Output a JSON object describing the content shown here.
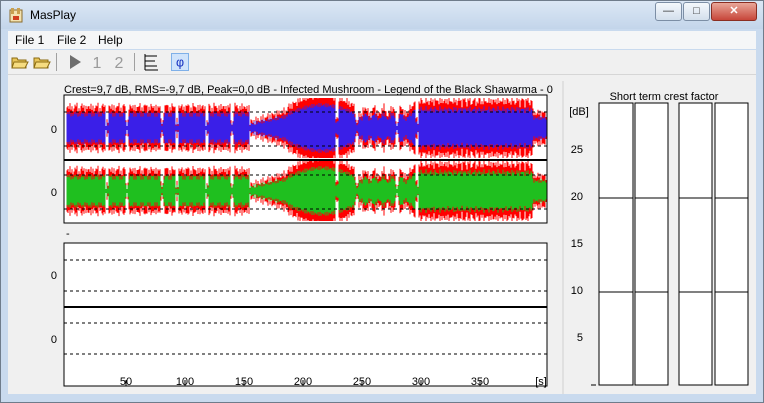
{
  "window": {
    "title": "MasPlay",
    "controls": {
      "minimize": "—",
      "maximize": "□",
      "close": "✕"
    }
  },
  "menu": {
    "items": [
      "File 1",
      "File 2",
      "Help"
    ]
  },
  "toolbar": {
    "buttons": [
      "open-file-1",
      "open-file-2",
      "play",
      "track-1",
      "track-2",
      "spectrum",
      "phase"
    ],
    "track1_label": "1",
    "track2_label": "2",
    "phase_label": "φ"
  },
  "waveform": {
    "info": "Crest=9,7 dB,  RMS=-9,7 dB,  Peak=0,0 dB  -  Infected Mushroom - Legend of the Black Shawarma - 0",
    "channel_zero_label": "0",
    "lower_caption": "-",
    "x_unit": "[s]",
    "x_ticks": [
      "50",
      "100",
      "150",
      "200",
      "250",
      "300",
      "350"
    ],
    "colors": {
      "left": "#3a1fe8",
      "right": "#1fbf1f",
      "clip": "#ff0000"
    }
  },
  "crest_panel": {
    "title": "Short term crest factor",
    "y_unit": "[dB]",
    "y_ticks": [
      "25",
      "20",
      "15",
      "10",
      "5"
    ]
  }
}
